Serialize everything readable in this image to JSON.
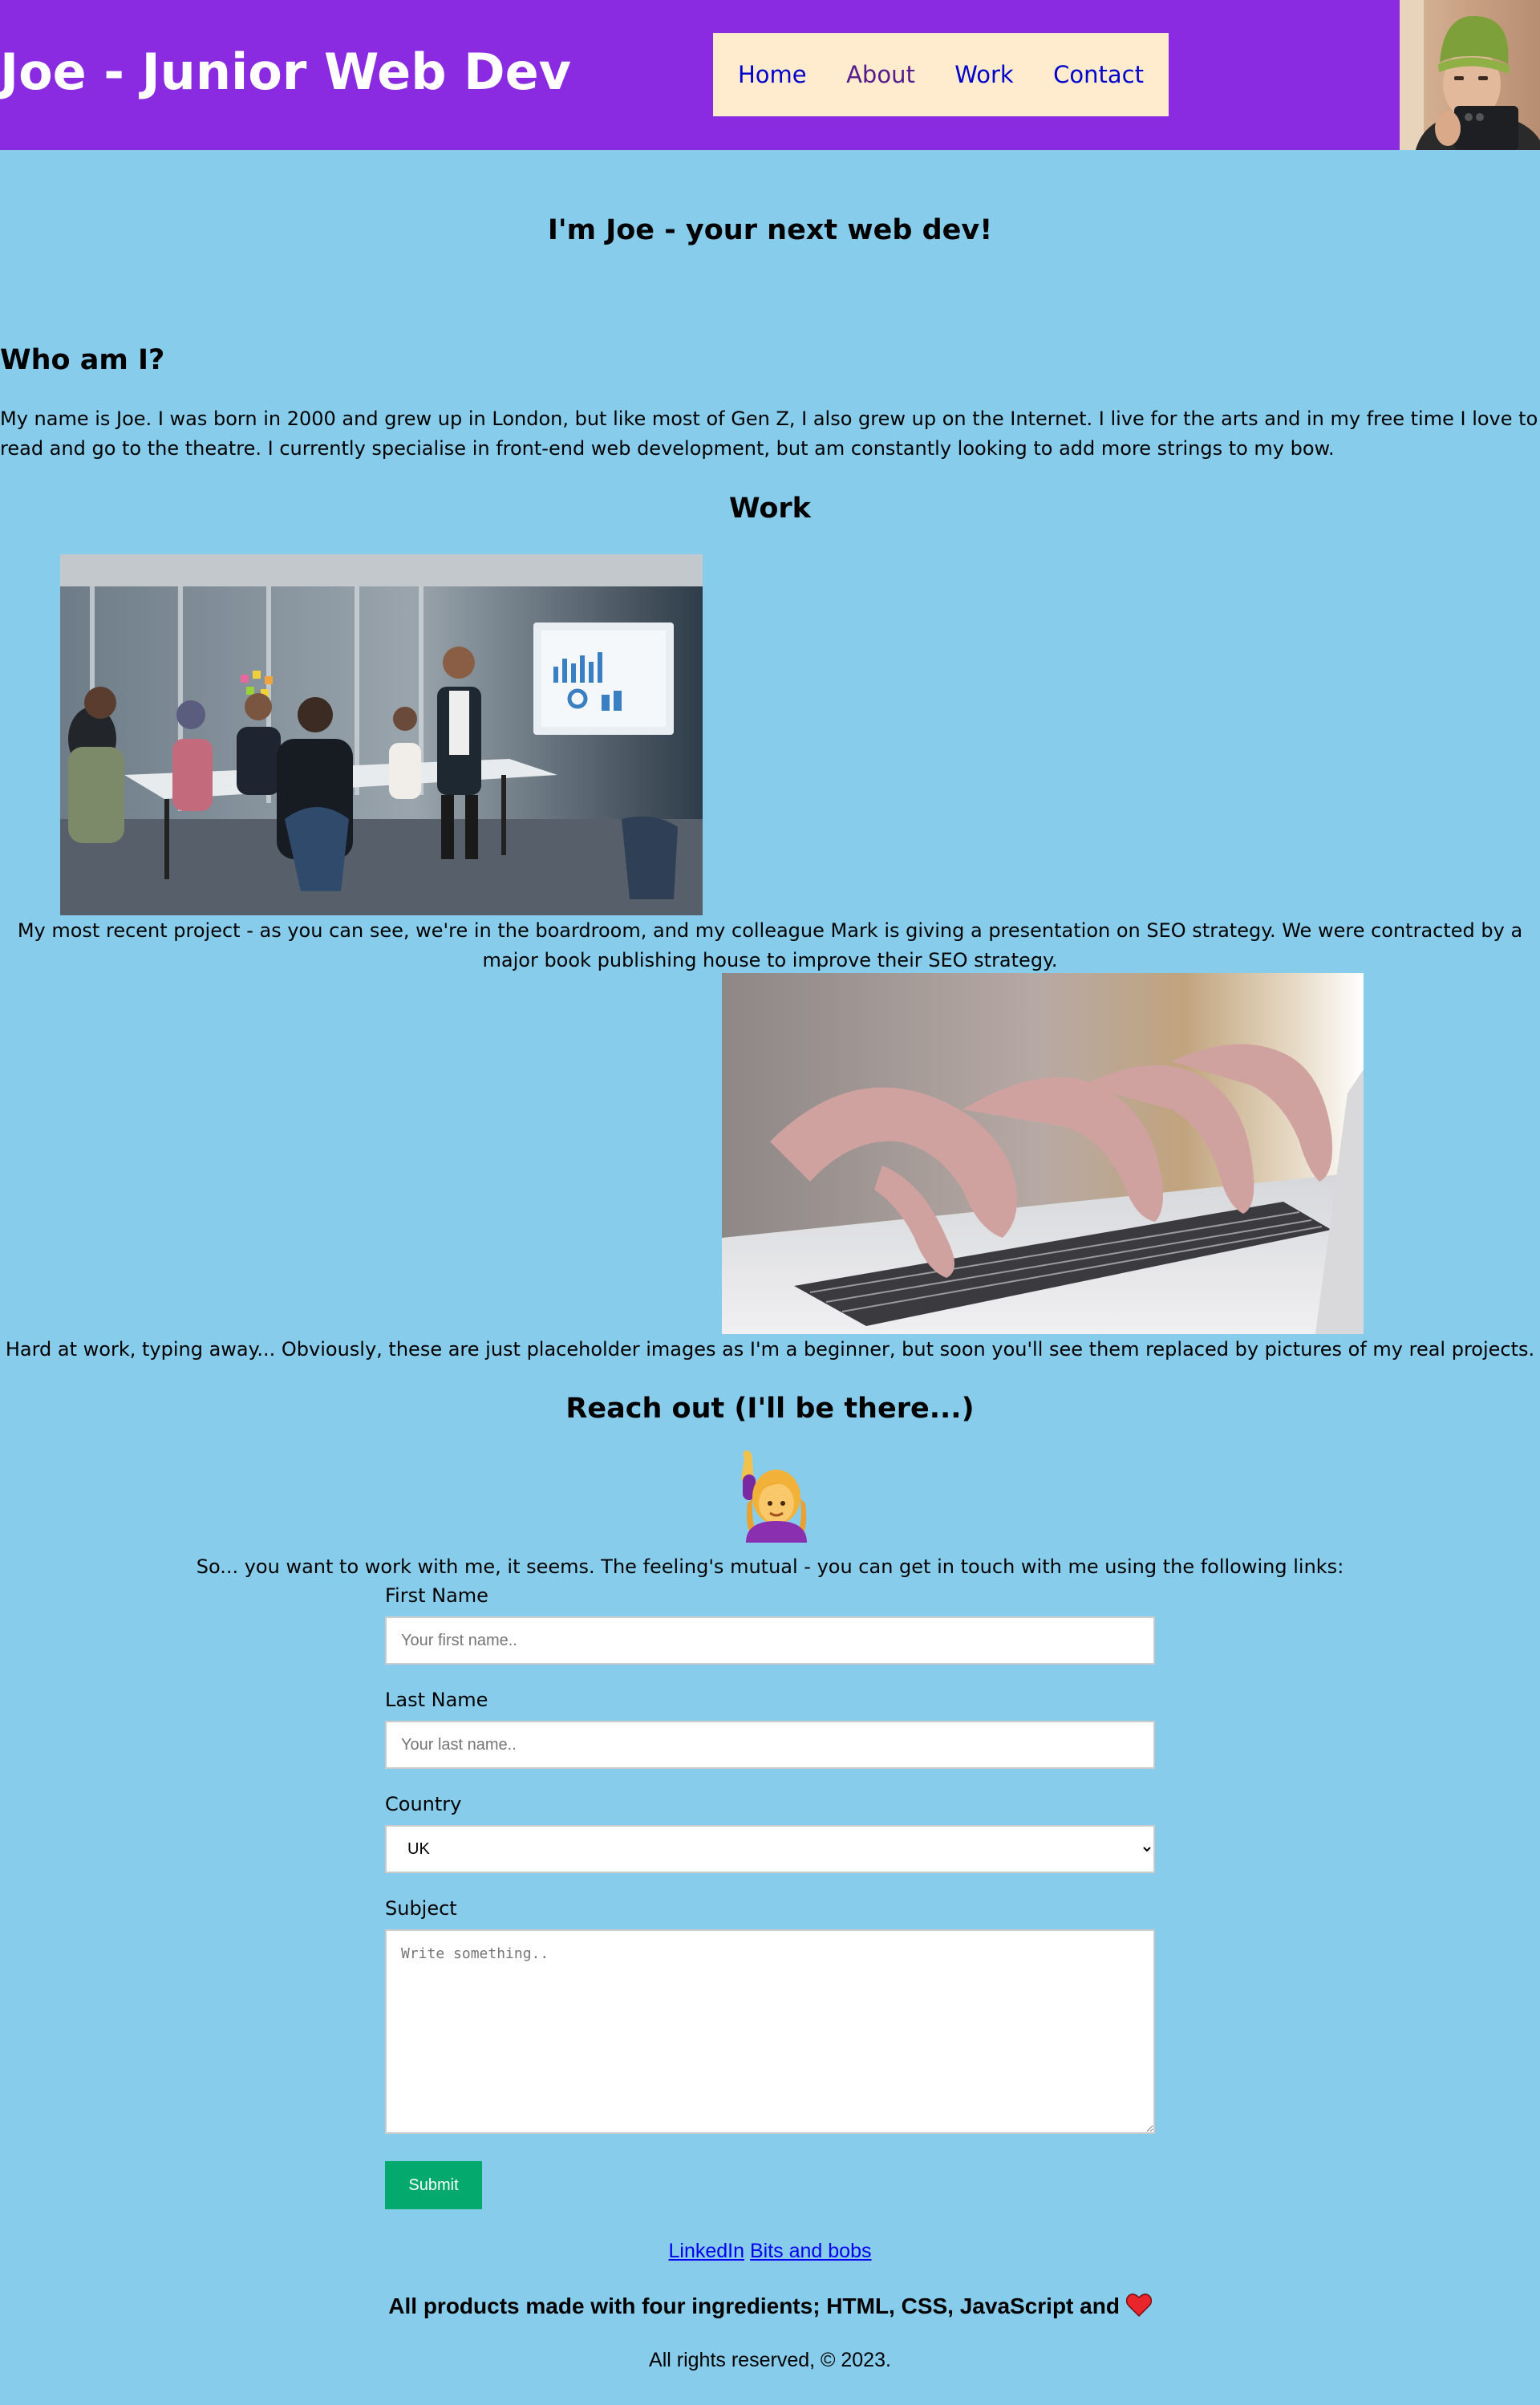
{
  "header": {
    "title": "Joe - Junior Web Dev",
    "nav": {
      "home": "Home",
      "about": "About",
      "work": "Work",
      "contact": "Contact"
    }
  },
  "hero": {
    "heading": "I'm Joe - your next web dev!"
  },
  "about": {
    "heading": "Who am I?",
    "bio": "My name is Joe. I was born in 2000 and grew up in London, but like most of Gen Z, I also grew up on the Internet. I live for the arts and in my free time I love to read and go to the theatre. I currently specialise in front-end web development, but am constantly looking to add more strings to my bow."
  },
  "work": {
    "heading": "Work",
    "caption1": "My most recent project - as you can see, we're in the boardroom, and my colleague Mark is giving a presentation on SEO strategy. We were contracted by a major book publishing house to improve their SEO strategy.",
    "caption2": "Hard at work, typing away... Obviously, these are just placeholder images as I'm a beginner, but soon you'll see them replaced by pictures of my real projects."
  },
  "contact": {
    "heading": "Reach out (I'll be there...)",
    "intro": "So... you want to work with me, it seems. The feeling's mutual - you can get in touch with me using the following links:",
    "form": {
      "first_name_label": "First Name",
      "first_name_placeholder": "Your first name..",
      "first_name_value": "",
      "last_name_label": "Last Name",
      "last_name_placeholder": "Your last name..",
      "last_name_value": "",
      "country_label": "Country",
      "country_selected": "UK",
      "subject_label": "Subject",
      "subject_placeholder": "Write something..",
      "subject_value": "",
      "submit_label": "Submit"
    }
  },
  "footer": {
    "links": {
      "linkedin": "LinkedIn",
      "bits": "Bits and bobs"
    },
    "tagline": "All products made with four ingredients; HTML, CSS, JavaScript and",
    "copyright": "All rights reserved, © 2023."
  },
  "icons": {
    "emoji": "person-raising-hand-icon",
    "heart": "heart-icon"
  },
  "colors": {
    "page_bg": "#87cceb",
    "header_bg": "#8a2be2",
    "nav_bg": "#ffebcd",
    "link": "#0000cc",
    "visited_link": "#551a8b",
    "submit_bg": "#04aa6d",
    "heart": "#e8262c"
  }
}
